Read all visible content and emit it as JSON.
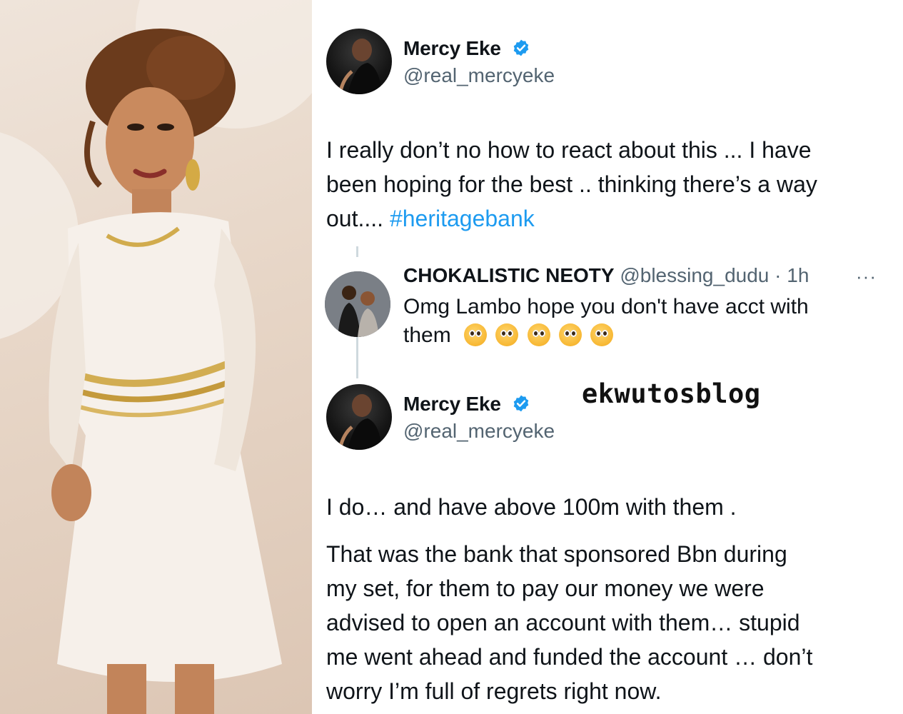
{
  "tweet1": {
    "name": "Mercy Eke",
    "handle": "@real_mercyeke",
    "text_line1": "I really don’t no how to react about this ... I have",
    "text_line2": "been hoping for the best .. thinking there’s a way",
    "text_line3_prefix": "out.... ",
    "hashtag": "#heritagebank"
  },
  "reply": {
    "name": "CHOKALISTIC NEOTY",
    "handle_time": " @blessing_dudu · 1h",
    "more": "···",
    "text_line1": "Omg Lambo hope you don't have acct with",
    "text_line2": "them",
    "emoji_name": "pleading-face-emoji"
  },
  "tweet2": {
    "name": "Mercy Eke",
    "handle": "@real_mercyeke",
    "para1": "I do… and have above 100m with them .",
    "para2_line1": "That was the bank that sponsored Bbn during",
    "para2_line2": "my set, for them to pay our money we were",
    "para2_line3": "advised to open an account with them… stupid",
    "para2_line4": "me went ahead and funded the account … don’t",
    "para2_line5": "worry I’m full of regrets right now."
  },
  "watermark": "ekwutosblog",
  "colors": {
    "verified_blue": "#1d9bf0",
    "hashtag_blue": "#1d9bf0",
    "handle_gray": "#536471",
    "thread_line": "#cfd9de"
  }
}
